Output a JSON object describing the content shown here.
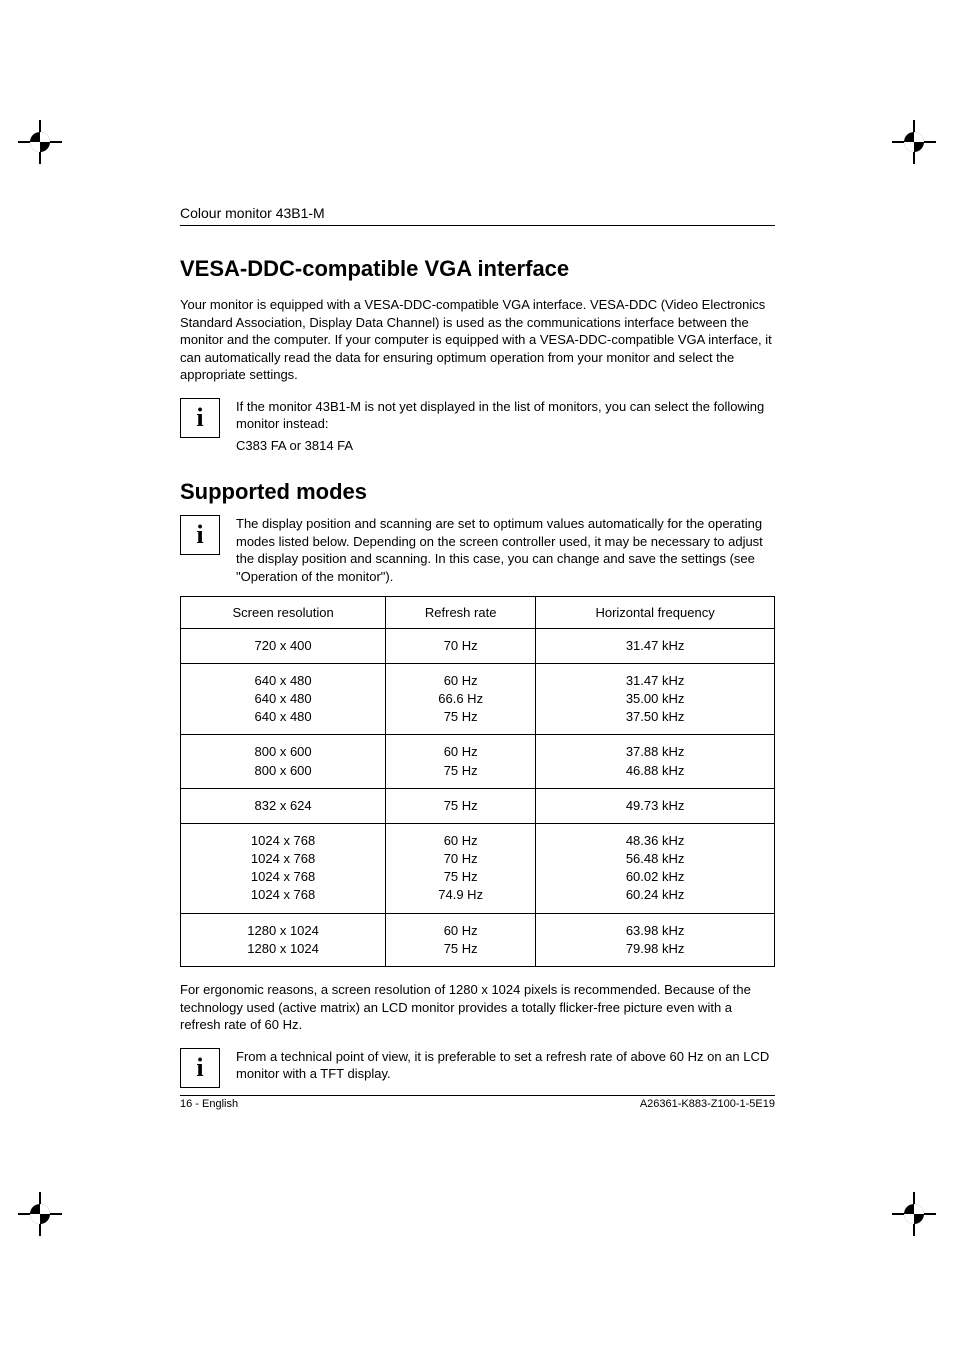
{
  "header": {
    "product": "Colour monitor 43B1-M"
  },
  "section1": {
    "title": "VESA-DDC-compatible VGA interface",
    "intro": "Your monitor is equipped with a VESA-DDC-compatible VGA interface. VESA-DDC (Video Electronics Standard Association, Display Data Channel) is used as the communications interface between the monitor and the computer. If your computer is equipped with a VESA-DDC-compatible VGA interface, it can automatically read the data for ensuring optimum operation from your monitor and select the appropriate settings.",
    "info1_line1": "If the monitor 43B1-M is not yet displayed in the list of monitors, you can select the following monitor instead:",
    "info1_line2": "C383 FA or 3814 FA"
  },
  "section2": {
    "title": "Supported modes",
    "info2": "The display position and scanning are set to optimum values automatically for the operating modes listed below. Depending on the screen controller used, it may be necessary to adjust the display position and scanning. In this case, you can change and save the settings (see \"Operation of the monitor\").",
    "table": {
      "headers": [
        "Screen resolution",
        "Refresh rate",
        "Horizontal frequency"
      ],
      "rows": [
        {
          "res": [
            "720 x 400"
          ],
          "rate": [
            "70 Hz"
          ],
          "freq": [
            "31.47 kHz"
          ]
        },
        {
          "res": [
            "640 x 480",
            "640 x 480",
            "640 x 480"
          ],
          "rate": [
            "60 Hz",
            "66.6 Hz",
            "75 Hz"
          ],
          "freq": [
            "31.47 kHz",
            "35.00 kHz",
            "37.50 kHz"
          ]
        },
        {
          "res": [
            "800 x 600",
            "800 x 600"
          ],
          "rate": [
            "60 Hz",
            "75 Hz"
          ],
          "freq": [
            "37.88 kHz",
            "46.88 kHz"
          ]
        },
        {
          "res": [
            "832 x 624"
          ],
          "rate": [
            "75 Hz"
          ],
          "freq": [
            "49.73 kHz"
          ]
        },
        {
          "res": [
            "1024 x 768",
            "1024 x 768",
            "1024 x 768",
            "1024 x 768"
          ],
          "rate": [
            "60 Hz",
            "70 Hz",
            "75 Hz",
            "74.9 Hz"
          ],
          "freq": [
            "48.36 kHz",
            "56.48 kHz",
            "60.02 kHz",
            "60.24 kHz"
          ]
        },
        {
          "res": [
            "1280 x 1024",
            "1280 x 1024"
          ],
          "rate": [
            "60 Hz",
            "75 Hz"
          ],
          "freq": [
            "63.98 kHz",
            "79.98 kHz"
          ]
        }
      ]
    },
    "para_after": "For ergonomic reasons, a screen resolution of 1280 x 1024 pixels is recommended. Because of the technology used (active matrix) an LCD monitor provides a totally flicker-free picture even with a refresh rate of 60 Hz.",
    "info3": "From a technical point of view, it is preferable to set a refresh rate of above 60 Hz on an LCD monitor with a TFT display."
  },
  "footer": {
    "left": "16 - English",
    "right": "A26361-K883-Z100-1-5E19"
  },
  "icons": {
    "info": "i"
  }
}
